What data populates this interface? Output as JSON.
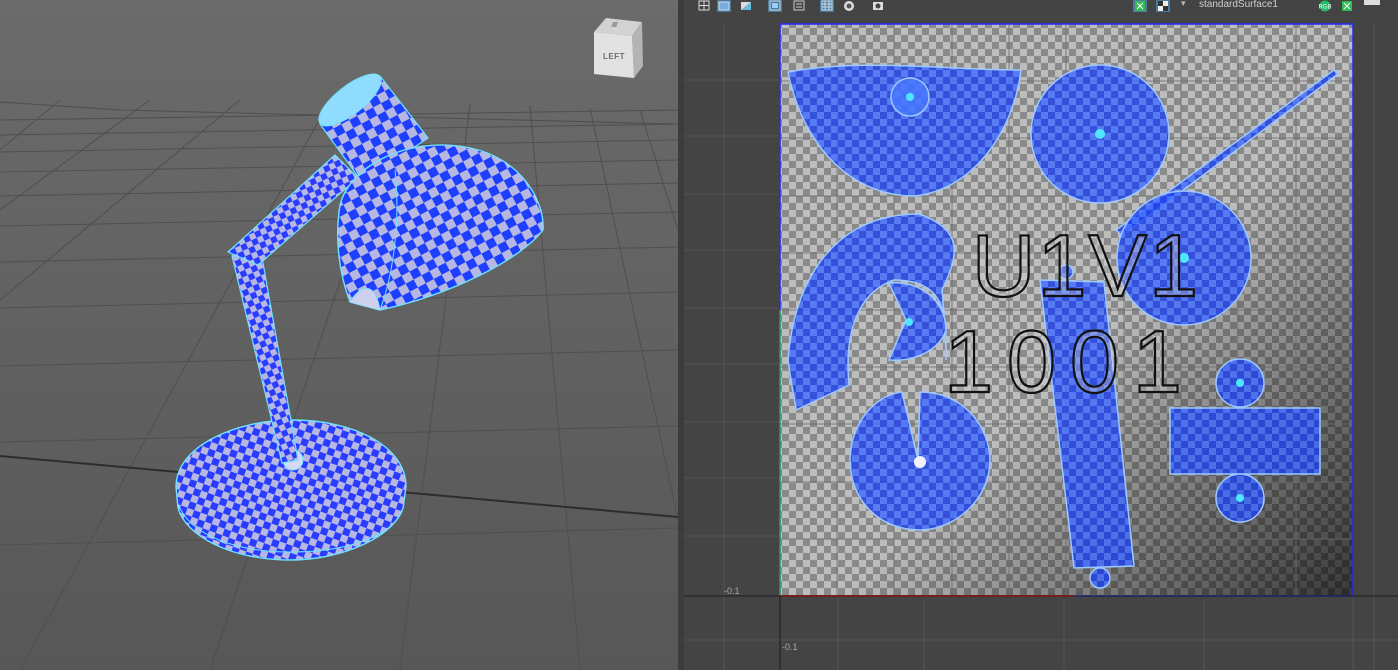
{
  "viewport": {
    "view_cube_label": "LEFT",
    "object": "desk-lamp",
    "checker_colors": [
      "#1f3fff",
      "#b7b7e3"
    ],
    "wire_color": "#6fe3ff"
  },
  "uv_editor": {
    "toolbar": {
      "shader_name": "standardSurface1",
      "icons": [
        "grid-icon",
        "uv-shell-icon",
        "shade-icon",
        "frame-icon",
        "snapshot-icon",
        "uv-grid-icon",
        "distortion-icon",
        "camera-icon",
        "checker-icon",
        "checker-map-icon",
        "dropdown-arrow-icon",
        "rgb-channels-icon",
        "alpha-channel-icon"
      ],
      "rgb_label": "RGB"
    },
    "tile_label_top": "U1V1",
    "tile_label_bottom": "1001",
    "axis_labels": {
      "left": "-0.1",
      "bottom": "-0.1"
    },
    "colors": {
      "u_axis": "#cc2222",
      "v_axis": "#22cc22",
      "tile_border": "#1f2bff",
      "shell_fill": "#2050ff",
      "shell_edge": "#9ec9ff"
    }
  }
}
